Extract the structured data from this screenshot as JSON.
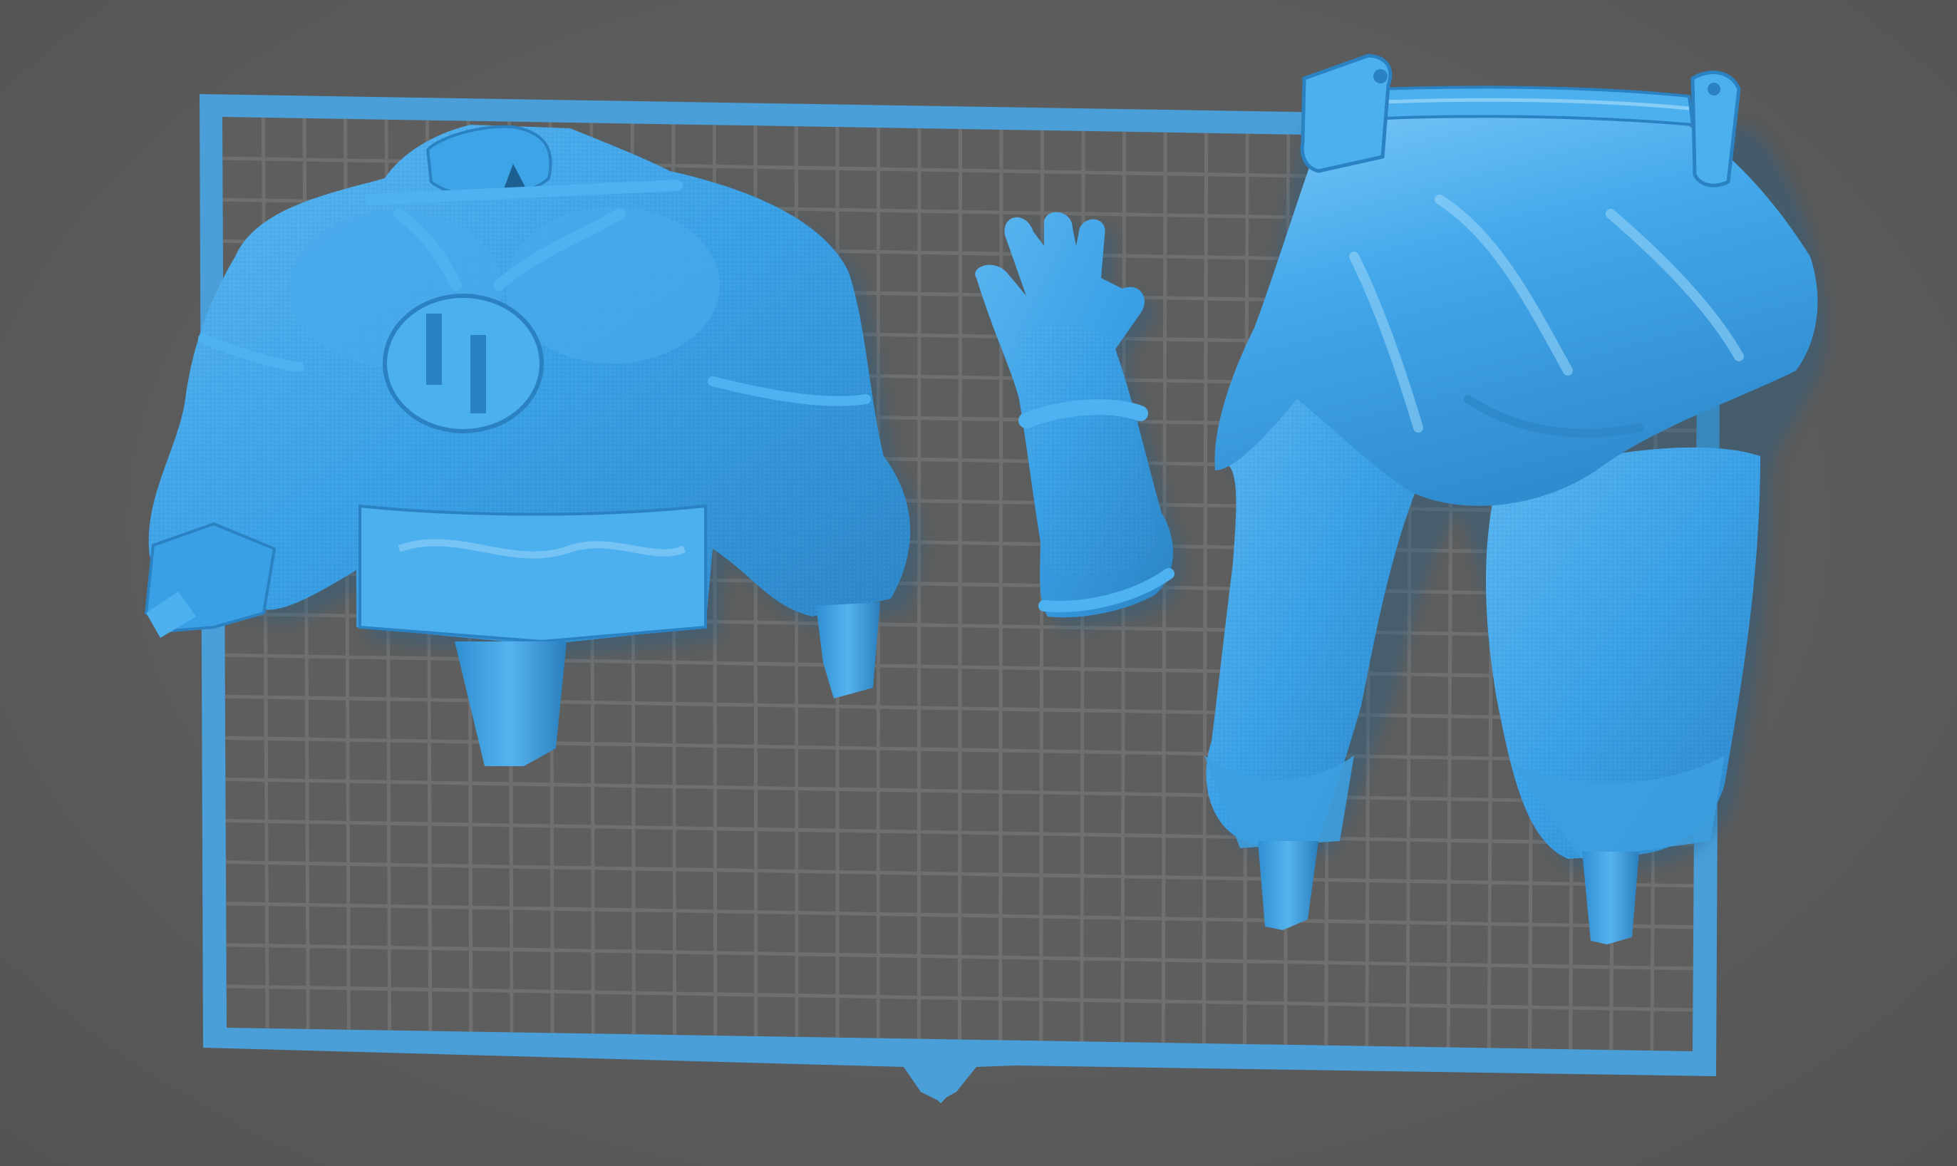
{
  "viewer": {
    "background_color": "#5c5c5c",
    "build_plate_color": "#4a9fd8",
    "grid_line_color": "#6f6f6f",
    "model_color": "#3aa0e6",
    "model_shadow_color": "#2b86c8",
    "model_highlight_color": "#8fd2ff"
  },
  "icons": {
    "plate_front_marker": "triangle-down-icon"
  },
  "models": [
    {
      "name": "torso-with-arms"
    },
    {
      "name": "forearm-with-hand"
    },
    {
      "name": "legs-with-loincloth"
    }
  ]
}
